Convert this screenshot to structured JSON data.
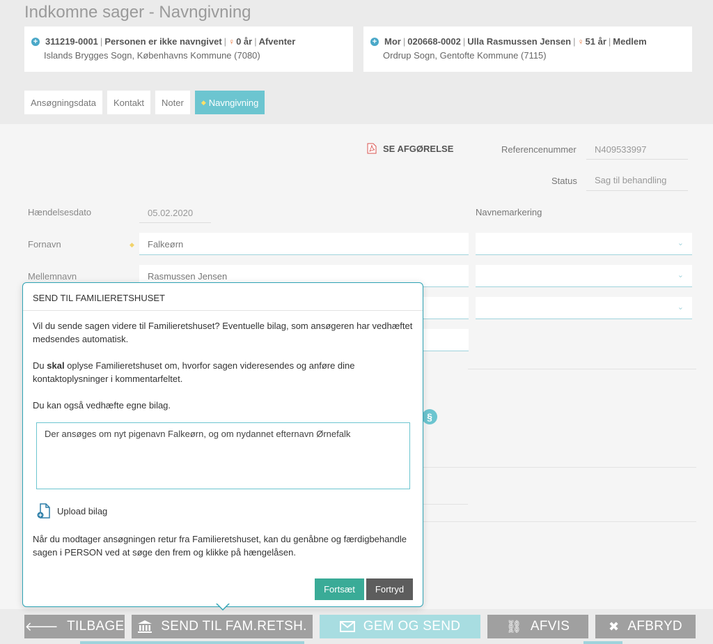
{
  "page": {
    "title": "Indkomne sager - Navngivning"
  },
  "persons": [
    {
      "id": "311219-0001",
      "name": "Personen er ikke navngivet",
      "age": "0 år",
      "status": "Afventer",
      "parish": "Islands Brygges Sogn, Københavns Kommune (7080)"
    },
    {
      "prefix": "Mor",
      "id": "020668-0002",
      "name": "Ulla Rasmussen Jensen",
      "age": "51 år",
      "status": "Medlem",
      "parish": "Ordrup Sogn, Gentofte Kommune (7115)"
    }
  ],
  "tabs": [
    {
      "label": "Ansøgningsdata"
    },
    {
      "label": "Kontakt"
    },
    {
      "label": "Noter"
    },
    {
      "label": "Navngivning"
    }
  ],
  "form": {
    "se_afgoerelse": "SE AFGØRELSE",
    "reference_label": "Referencenummer",
    "reference_value": "N409533997",
    "status_label": "Status",
    "status_value": "Sag til behandling",
    "event_date_label": "Hændelsesdato",
    "event_date_value": "05.02.2020",
    "navnemarkering_label": "Navnemarkering",
    "fornavn_label": "Fornavn",
    "fornavn_value": "Falkeørn",
    "mellemnavn_label": "Mellemnavn",
    "mellemnavn_value": "Rasmussen Jensen"
  },
  "modal": {
    "title": "SEND TIL FAMILIERETSHUSET",
    "para1": "Vil du sende sagen videre til Familieretshuset? Eventuelle bilag, som ansøgeren har vedhæftet medsendes automatisk.",
    "para2_pre": "Du",
    "para2_bold": "skal",
    "para2_post": "oplyse Familieretshuset om, hvorfor sagen videresendes og anføre dine kontaktoplysninger i kommentarfeltet.",
    "para3": "Du kan også vedhæfte egne bilag.",
    "comment": "Der ansøges om nyt pigenavn Falkeørn, og om nydannet efternavn Ørnefalk",
    "upload_label": "Upload bilag",
    "note": "Når du modtager ansøgningen retur fra Familieretshuset, kan du genåbne og færdigbehandle sagen i PERSON ved at søge den frem og klikke på hængelåsen.",
    "continue_label": "Fortsæt",
    "cancel_label": "Fortryd"
  },
  "footer": {
    "back": "TILBAGE",
    "send": "SEND TIL FAM.RETSH.",
    "save_send": "GEM OG SEND",
    "reject": "AFVIS",
    "abort": "AFBRYD"
  },
  "colors": {
    "accent": "#6cc5d0",
    "modal_border": "#2ea3b4",
    "continue": "#3aab97",
    "cancel": "#5d5d5d"
  }
}
